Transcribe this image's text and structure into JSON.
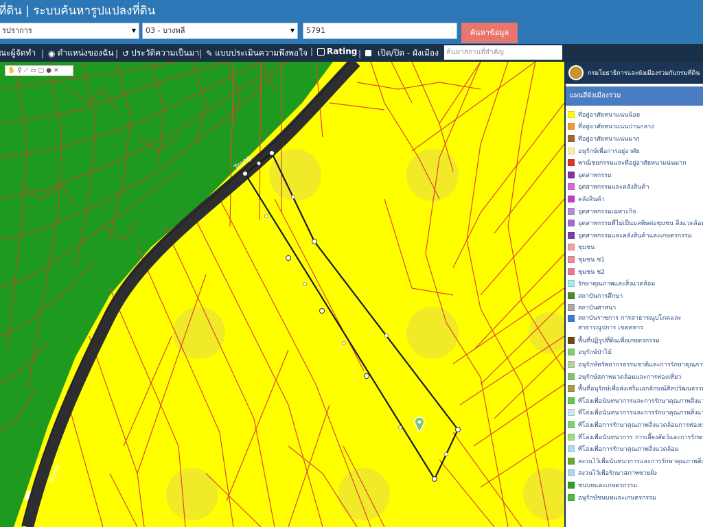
{
  "header": {
    "title": "ที่ดิน | ระบบค้นหารูปแปลงที่ดิน"
  },
  "search": {
    "province": "รปราการ",
    "district": "03 - บางพลี",
    "parcel_value": "5791",
    "button_label": "ค้นหาข้อมูล"
  },
  "toolbar": {
    "items": [
      "ณะผู้จัดทำ",
      "ตำแหน่งของฉัน",
      "ประวัติความเป็นมา",
      "แบบประเมินความพึงพอใจ",
      "Rating",
      "เปิด/ปิด - ผังเมือง"
    ],
    "place_placeholder": "ค้นหาสถานที่สำคัญ"
  },
  "map": {
    "road_label": "Trong",
    "colors": {
      "residential_low": "#ffff00",
      "agricultural": "#1e9b1e",
      "parcel_line": "#e0462a",
      "road": "#2e2e30",
      "selected_outline": "#1a1a1a"
    }
  },
  "legend": {
    "header": "กรมโยธาธิการและผังเมืองร่วมกับกรมที่ดิน",
    "subtitle": "แผนสีผังเมืองรวม",
    "items": [
      {
        "label": "ที่อยู่อาศัยหนาแน่นน้อย",
        "color": "#ffff00"
      },
      {
        "label": "ที่อยู่อาศัยหนาแน่นปานกลาง",
        "color": "#f39c3a"
      },
      {
        "label": "ที่อยู่อาศัยหนาแน่นมาก",
        "color": "#a8672d"
      },
      {
        "label": "อนุรักษ์เพื่อการอยู่อาศัย",
        "color": "#f7f39a"
      },
      {
        "label": "พาณิชยกรรมและที่อยู่อาศัยหนาแน่นมาก",
        "color": "#e0302a"
      },
      {
        "label": "อุตสาหกรรม",
        "color": "#8b2ea0"
      },
      {
        "label": "อุตสาหกรรมและคลังสินค้า",
        "color": "#d66ad8"
      },
      {
        "label": "คลังสินค้า",
        "color": "#c838d0"
      },
      {
        "label": "อุตสาหกรรมเฉพาะกิจ",
        "color": "#b58ad6"
      },
      {
        "label": "อุตสาหกรรมที่ไม่เป็นมลพิษต่อชุมชน สิ่งแวดล้อมและ",
        "color": "#a36bd8"
      },
      {
        "label": "อุตสาหกรรมและคลังสินค้าและเกษตรกรรม",
        "color": "#7c3fa6"
      },
      {
        "label": "ชุมชน",
        "color": "#f2a0a8"
      },
      {
        "label": "ชุมชน ช1",
        "color": "#f08a94"
      },
      {
        "label": "ชุมชน ช2",
        "color": "#ea7b86"
      },
      {
        "label": "รักษาคุณภาพและสิ่งแวดล้อม",
        "color": "#a3ece6"
      },
      {
        "label": "สถาบันการศึกษา",
        "color": "#4a8a2a"
      },
      {
        "label": "สถาบันศาสนา",
        "color": "#aaaaaa"
      },
      {
        "label": "สถาบันราชการ การสาธารณูปโภคและสาธารณูปการ เขตทหาร",
        "color": "#3a7cd6",
        "two": true
      },
      {
        "label": "พื้นที่ปฏิรูปที่ดินเพื่อเกษตรกรรม",
        "color": "#6b4a10"
      },
      {
        "label": "อนุรักษ์ป่าไม้",
        "color": "#7ccf6a"
      },
      {
        "label": "อนุรักษ์ทรัพยากรธรรมชาติและการรักษาคุณภาพสิ่ง",
        "color": "#b7d49a"
      },
      {
        "label": "อนุรักษ์สภาพแวดล้อมและการท่องเที่ยว",
        "color": "#86c270"
      },
      {
        "label": "พื้นที่อนุรักษ์เพื่อส่งเสริมเอกลักษณ์ศิลปวัฒนธรรมไท",
        "color": "#a8a040"
      },
      {
        "label": "ที่โล่งเพื่อนันทนาการและการรักษาคุณภาพสิ่งแวดล้",
        "color": "#5ccf4a"
      },
      {
        "label": "ที่โล่งเพื่อนันทนาการและการรักษาคุณภาพสิ่งแวดล้",
        "color": "#c9e6f2"
      },
      {
        "label": "ที่โล่งเพื่อการรักษาคุณภาพสิ่งแวดล้อมการท่องเที่ยว",
        "color": "#7ad270"
      },
      {
        "label": "ที่โล่งเพื่อนันทนาการ การเลี้ยงสัตว์และการรักษาคุณ",
        "color": "#9fdc80"
      },
      {
        "label": "ที่โล่งเพื่อการรักษาคุณภาพสิ่งแวดล้อม",
        "color": "#a9e0f0"
      },
      {
        "label": "สงวนไว้เพื่อนันทนาการและการรักษาคุณภาพสิ่งแวดล",
        "color": "#6aa82e"
      },
      {
        "label": "สงวนไว้เพื่อรักษาสภาพชายฝั่ง",
        "color": "#a8d8f0"
      },
      {
        "label": "ชนบทและเกษตรกรรม",
        "color": "#2ea02e"
      },
      {
        "label": "อนุรักษ์ชนบทและเกษตรกรรม",
        "color": "#4cba40"
      }
    ]
  }
}
